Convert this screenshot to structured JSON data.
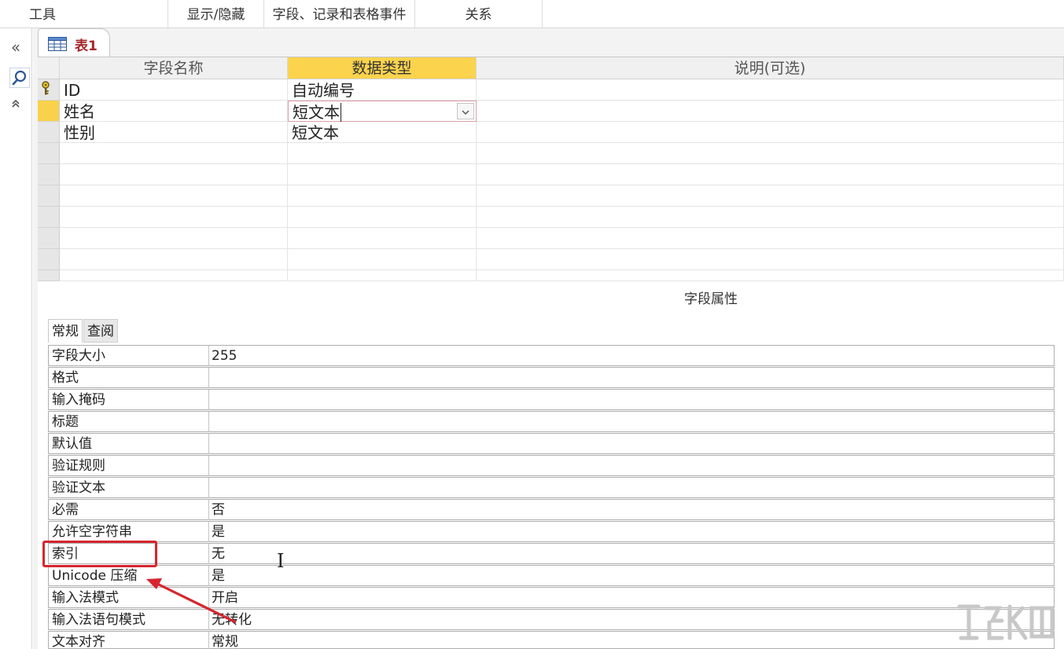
{
  "ribbon": {
    "groups": [
      "工具",
      "显示/隐藏",
      "字段、记录和表格事件",
      "关系"
    ]
  },
  "nav": {
    "collapse_glyph": "«",
    "expand_glyph": "⌃"
  },
  "document_tab": {
    "label": "表1"
  },
  "grid": {
    "headers": {
      "field_name": "字段名称",
      "data_type": "数据类型",
      "description": "说明(可选)"
    },
    "rows": [
      {
        "field_name": "ID",
        "data_type": "自动编号",
        "primary_key": true
      },
      {
        "field_name": "姓名",
        "data_type": "短文本",
        "current": true
      },
      {
        "field_name": "性别",
        "data_type": "短文本"
      }
    ]
  },
  "field_properties": {
    "title": "字段属性",
    "tabs": [
      "常规",
      "查阅"
    ],
    "rows": [
      {
        "name": "字段大小",
        "value": "255"
      },
      {
        "name": "格式",
        "value": ""
      },
      {
        "name": "输入掩码",
        "value": ""
      },
      {
        "name": "标题",
        "value": ""
      },
      {
        "name": "默认值",
        "value": ""
      },
      {
        "name": "验证规则",
        "value": ""
      },
      {
        "name": "验证文本",
        "value": ""
      },
      {
        "name": "必需",
        "value": "否"
      },
      {
        "name": "允许空字符串",
        "value": "是"
      },
      {
        "name": "索引",
        "value": "无"
      },
      {
        "name": "Unicode 压缩",
        "value": "是"
      },
      {
        "name": "输入法模式",
        "value": "开启"
      },
      {
        "name": "输入法语句模式",
        "value": "无转化"
      },
      {
        "name": "文本对齐",
        "value": "常规"
      }
    ]
  },
  "colors": {
    "selected_header": "#fbd34d",
    "tab_label": "#a4262c",
    "annotation": "#d7252e"
  }
}
